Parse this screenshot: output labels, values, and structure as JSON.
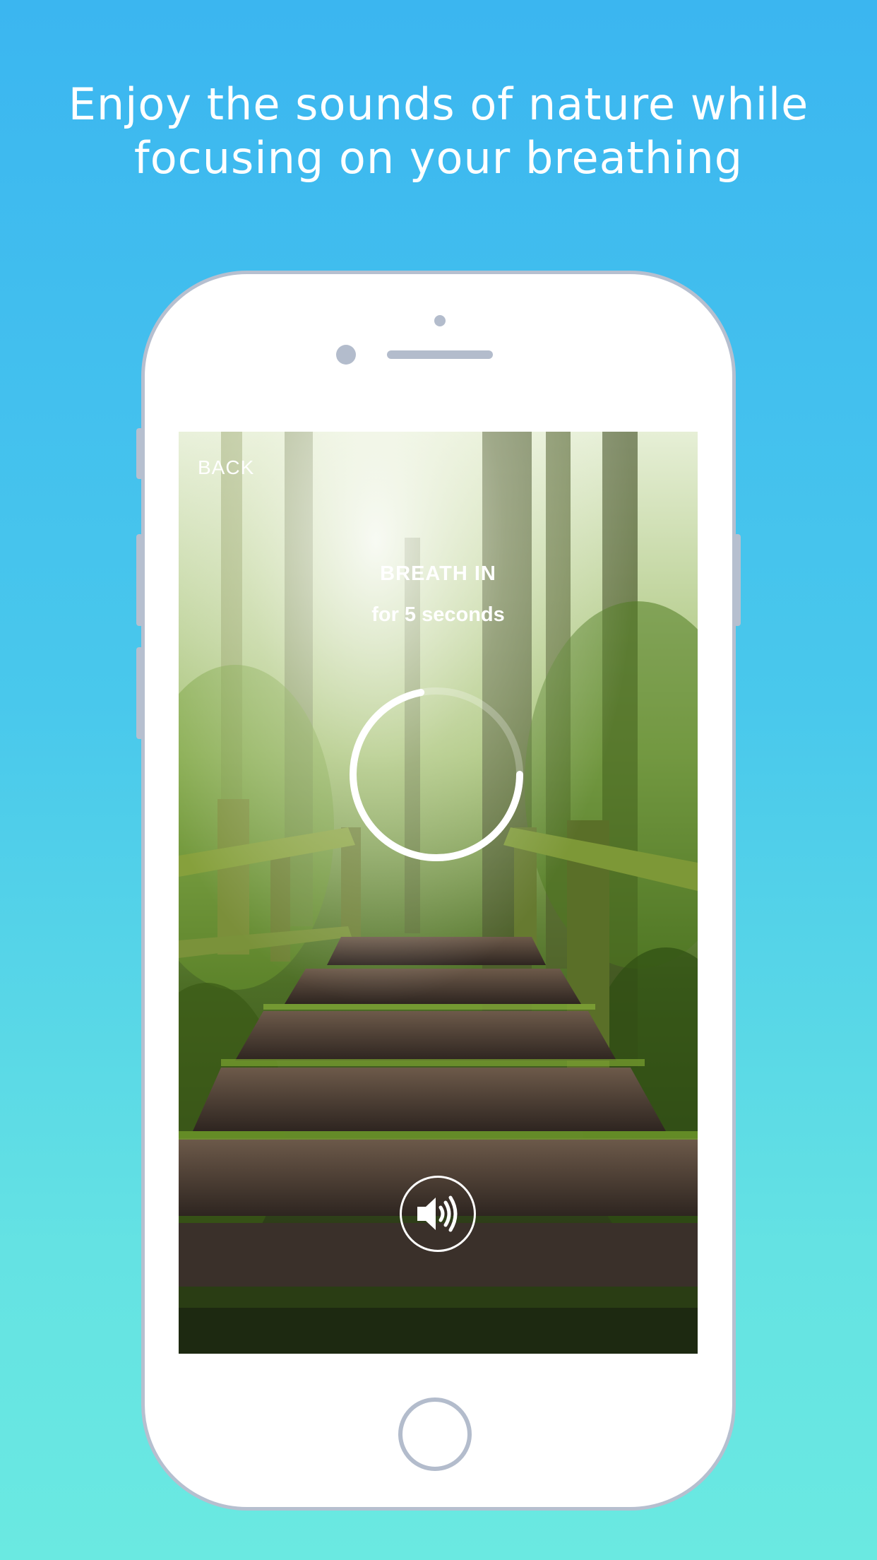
{
  "headline": {
    "line1": "Enjoy the sounds of nature while",
    "line2": "focusing on your breathing"
  },
  "screen": {
    "back_label": "BACK",
    "instruction_title": "BREATH IN",
    "instruction_subtitle": "for 5 seconds",
    "breath_progress": 0.72,
    "sound_icon": "speaker-volume-icon"
  },
  "colors": {
    "background_top": "#3bb6f0",
    "background_bottom": "#6ae9e1",
    "phone_frame": "#b6bfcf",
    "text": "#ffffff"
  }
}
